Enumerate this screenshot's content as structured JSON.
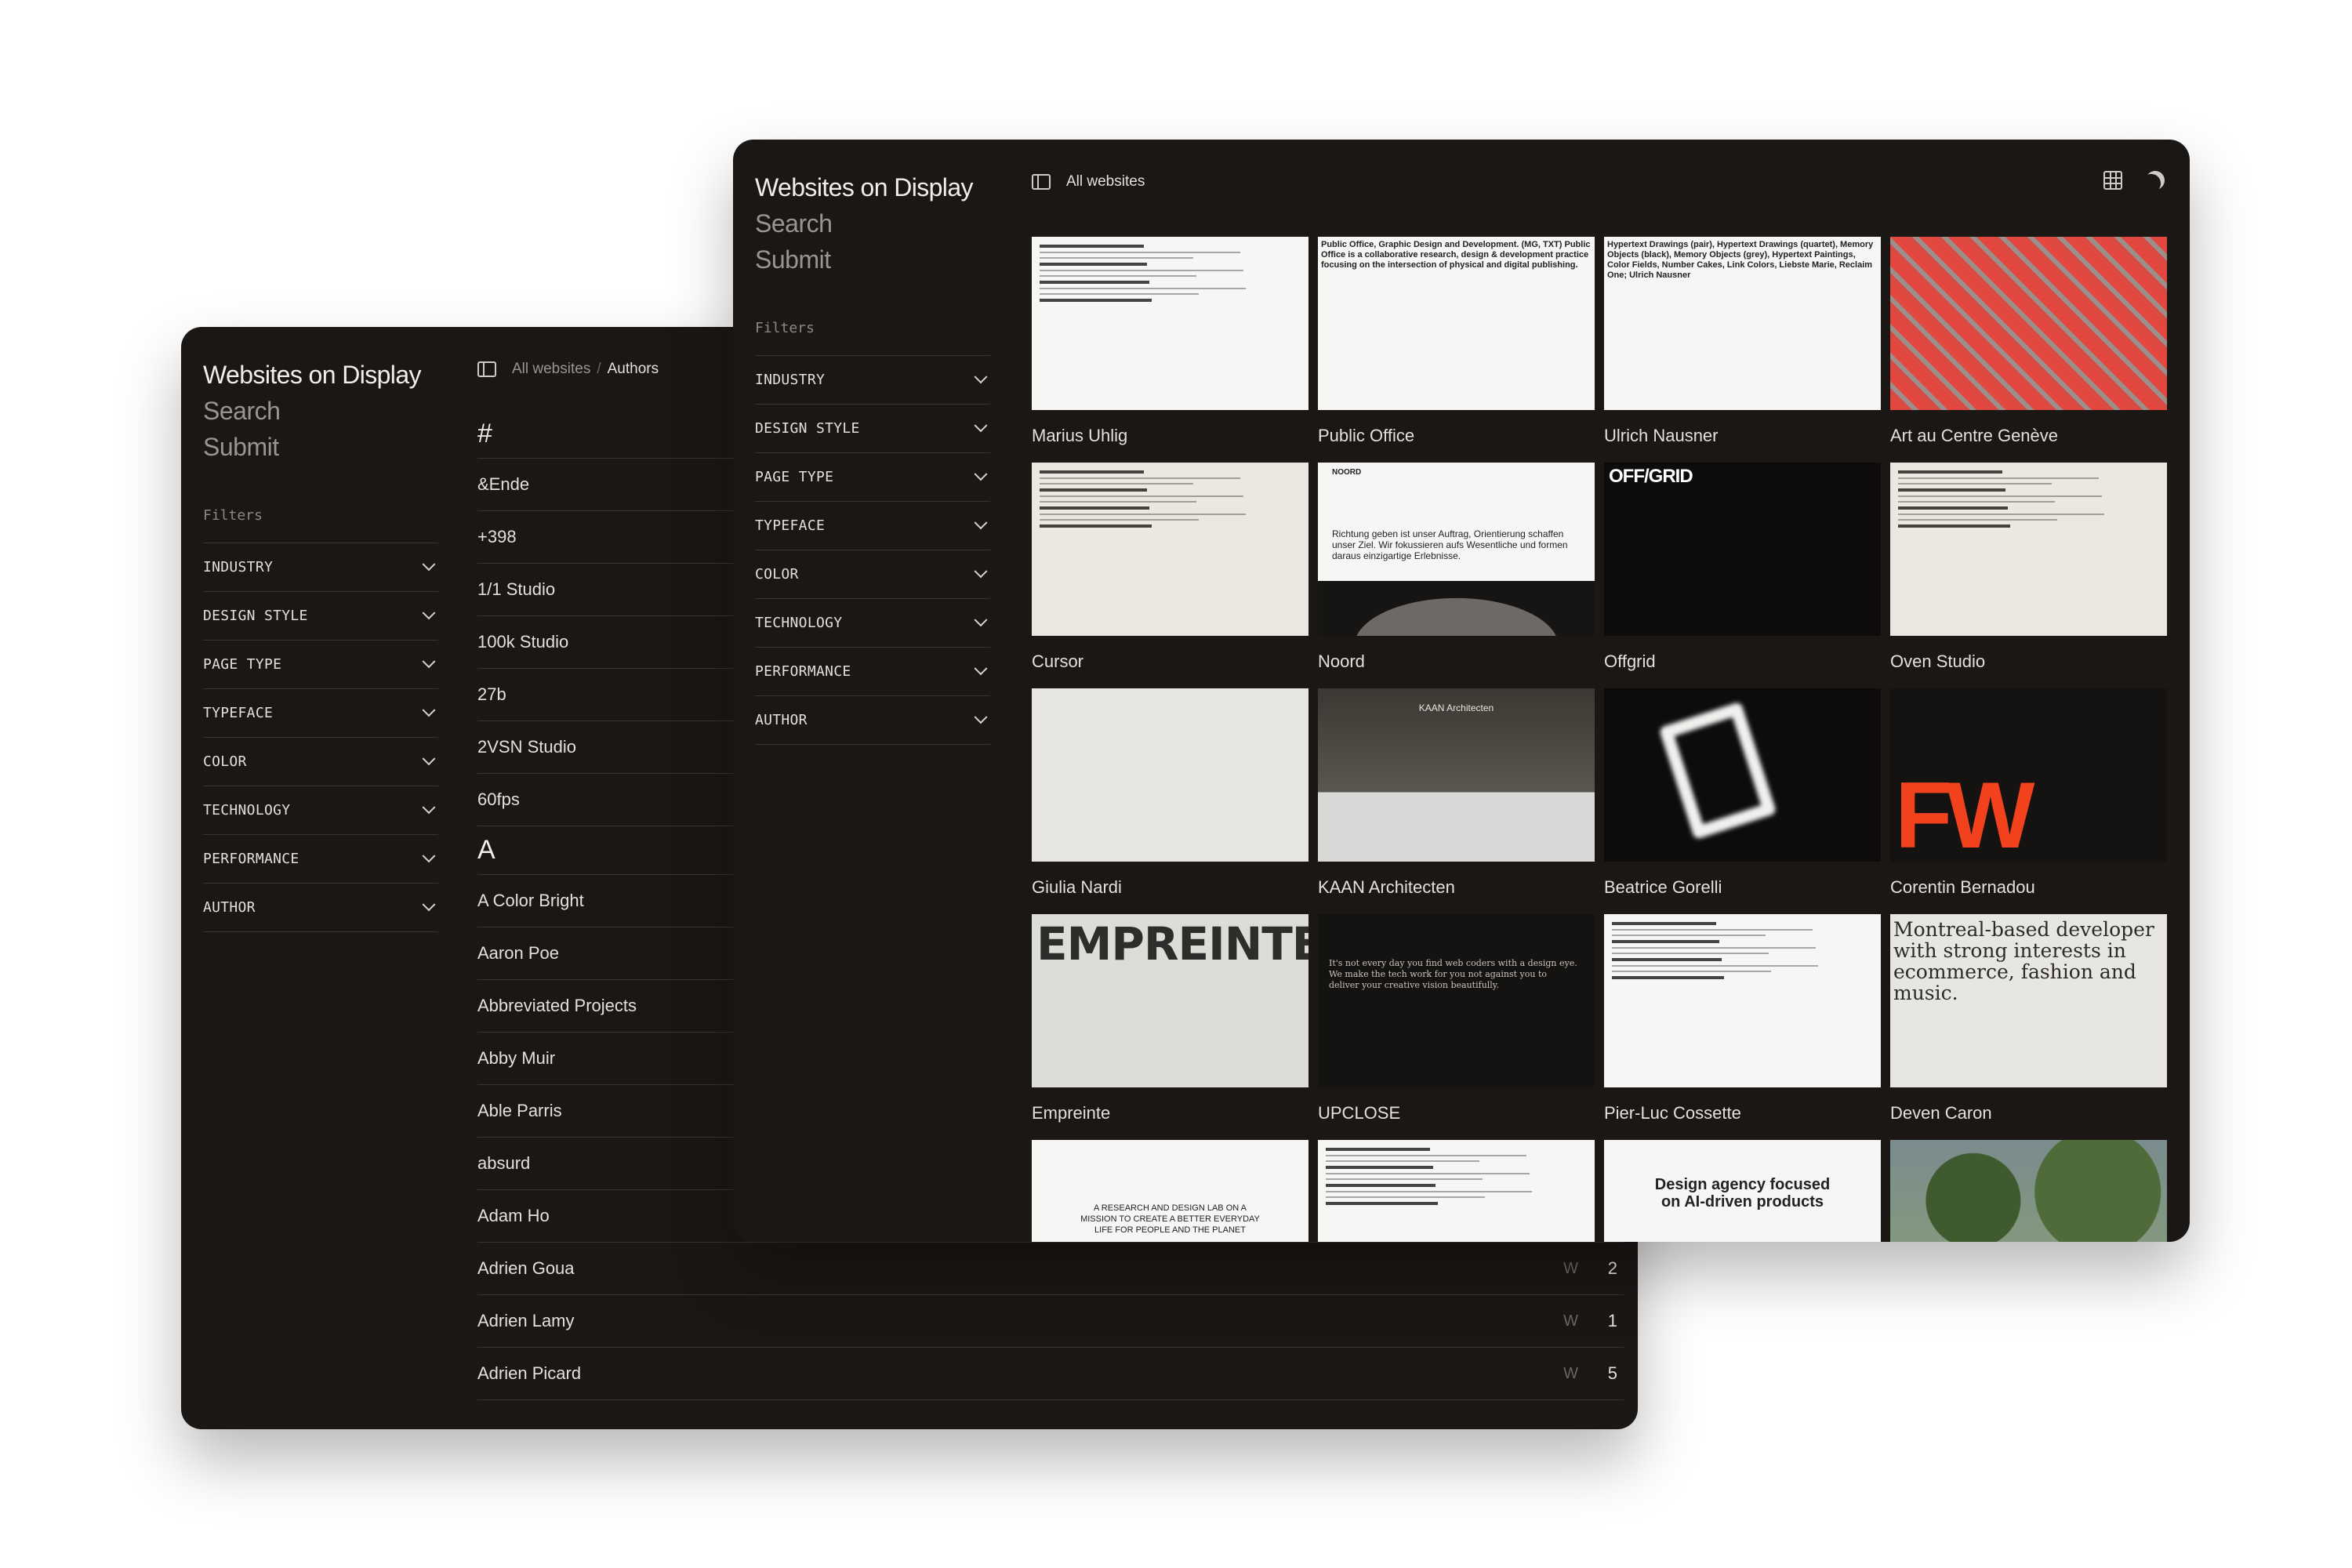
{
  "brand": "Websites on Display",
  "nav": {
    "search": "Search",
    "submit": "Submit"
  },
  "filters": {
    "label": "Filters",
    "items": [
      "INDUSTRY",
      "DESIGN STYLE",
      "PAGE TYPE",
      "TYPEFACE",
      "COLOR",
      "TECHNOLOGY",
      "PERFORMANCE",
      "AUTHOR"
    ]
  },
  "back_window": {
    "breadcrumb": {
      "root": "All websites",
      "sep": "/",
      "current": "Authors"
    },
    "groups": [
      {
        "letter": "#",
        "authors": [
          {
            "name": "&Ende"
          },
          {
            "name": "+398"
          },
          {
            "name": "1/1 Studio"
          },
          {
            "name": "100k Studio"
          },
          {
            "name": "27b"
          },
          {
            "name": "2VSN Studio"
          },
          {
            "name": "60fps"
          }
        ]
      },
      {
        "letter": "A",
        "authors": [
          {
            "name": "A Color Bright"
          },
          {
            "name": "Aaron Poe"
          },
          {
            "name": "Abbreviated Projects"
          },
          {
            "name": "Abby Muir"
          },
          {
            "name": "Able Parris"
          },
          {
            "name": "absurd"
          },
          {
            "name": "Adam Ho"
          },
          {
            "name": "Adrien Goua",
            "mark": "W",
            "count": "2"
          },
          {
            "name": "Adrien Lamy",
            "mark": "W",
            "count": "1"
          },
          {
            "name": "Adrien Picard",
            "mark": "W",
            "count": "5"
          }
        ]
      }
    ]
  },
  "front_window": {
    "breadcrumb": {
      "current": "All websites"
    },
    "sites": [
      {
        "name": "Marius Uhlig",
        "style": "t-white",
        "kind": "lines"
      },
      {
        "name": "Public Office",
        "style": "t-white",
        "kind": "text",
        "text": "Public Office, Graphic Design and Development. (MG, TXT) Public Office is a collaborative research, design & development practice focusing on the intersection of physical and digital publishing."
      },
      {
        "name": "Ulrich Nausner",
        "style": "t-white",
        "kind": "text",
        "text": "Hypertext Drawings (pair), Hypertext Drawings (quartet), Memory Objects (black), Memory Objects (grey), Hypertext Paintings, Color Fields, Number Cakes, Link Colors, Liebste Marie, Reclaim One; Ulrich Nausner"
      },
      {
        "name": "Art au Centre Genève",
        "style": "t-red",
        "kind": "plain"
      },
      {
        "name": "Cursor",
        "style": "t-cream",
        "kind": "lines"
      },
      {
        "name": "Noord",
        "style": "t-white",
        "kind": "noord",
        "logo": "NOORD",
        "text": "Richtung geben ist unser Auftrag, Orientierung schaffen unser Ziel. Wir fokussieren aufs Wesentliche und formen daraus einzigartige Erlebnisse."
      },
      {
        "name": "Offgrid",
        "style": "t-dark",
        "kind": "offgrid",
        "logo": "OFF/GRID"
      },
      {
        "name": "Oven Studio",
        "style": "t-cream",
        "kind": "lines"
      },
      {
        "name": "Giulia Nardi",
        "style": "t-mid",
        "kind": "plain"
      },
      {
        "name": "KAAN Architecten",
        "style": "t-olive",
        "kind": "kaan",
        "logo": "KAAN Architecten"
      },
      {
        "name": "Beatrice Gorelli",
        "style": "t-dark",
        "kind": "shape"
      },
      {
        "name": "Corentin Bernadou",
        "style": "t-ink",
        "kind": "fw",
        "logo": "FW"
      },
      {
        "name": "Empreinte",
        "style": "t-grey",
        "kind": "big",
        "logo": "EMPREINTE"
      },
      {
        "name": "UPCLOSE",
        "style": "t-ink",
        "kind": "serif-dark",
        "text": "It's not every day you find web coders with a design eye. We make the tech work for you not against you to deliver your creative vision beautifully."
      },
      {
        "name": "Pier-Luc Cossette",
        "style": "t-white",
        "kind": "lines"
      },
      {
        "name": "Deven Caron",
        "style": "t-mid",
        "kind": "serif",
        "text": "Montreal-based developer with strong interests in ecommerce, fashion and music."
      },
      {
        "name": "",
        "style": "t-white",
        "kind": "center",
        "text": "A RESEARCH AND DESIGN LAB ON A MISSION TO CREATE A BETTER EVERYDAY LIFE FOR PEOPLE AND THE PLANET"
      },
      {
        "name": "",
        "style": "t-white",
        "kind": "lines"
      },
      {
        "name": "",
        "style": "t-white",
        "kind": "center-big",
        "text": "Design agency focused on AI-driven products"
      },
      {
        "name": "",
        "style": "t-green",
        "kind": "plain"
      }
    ]
  }
}
